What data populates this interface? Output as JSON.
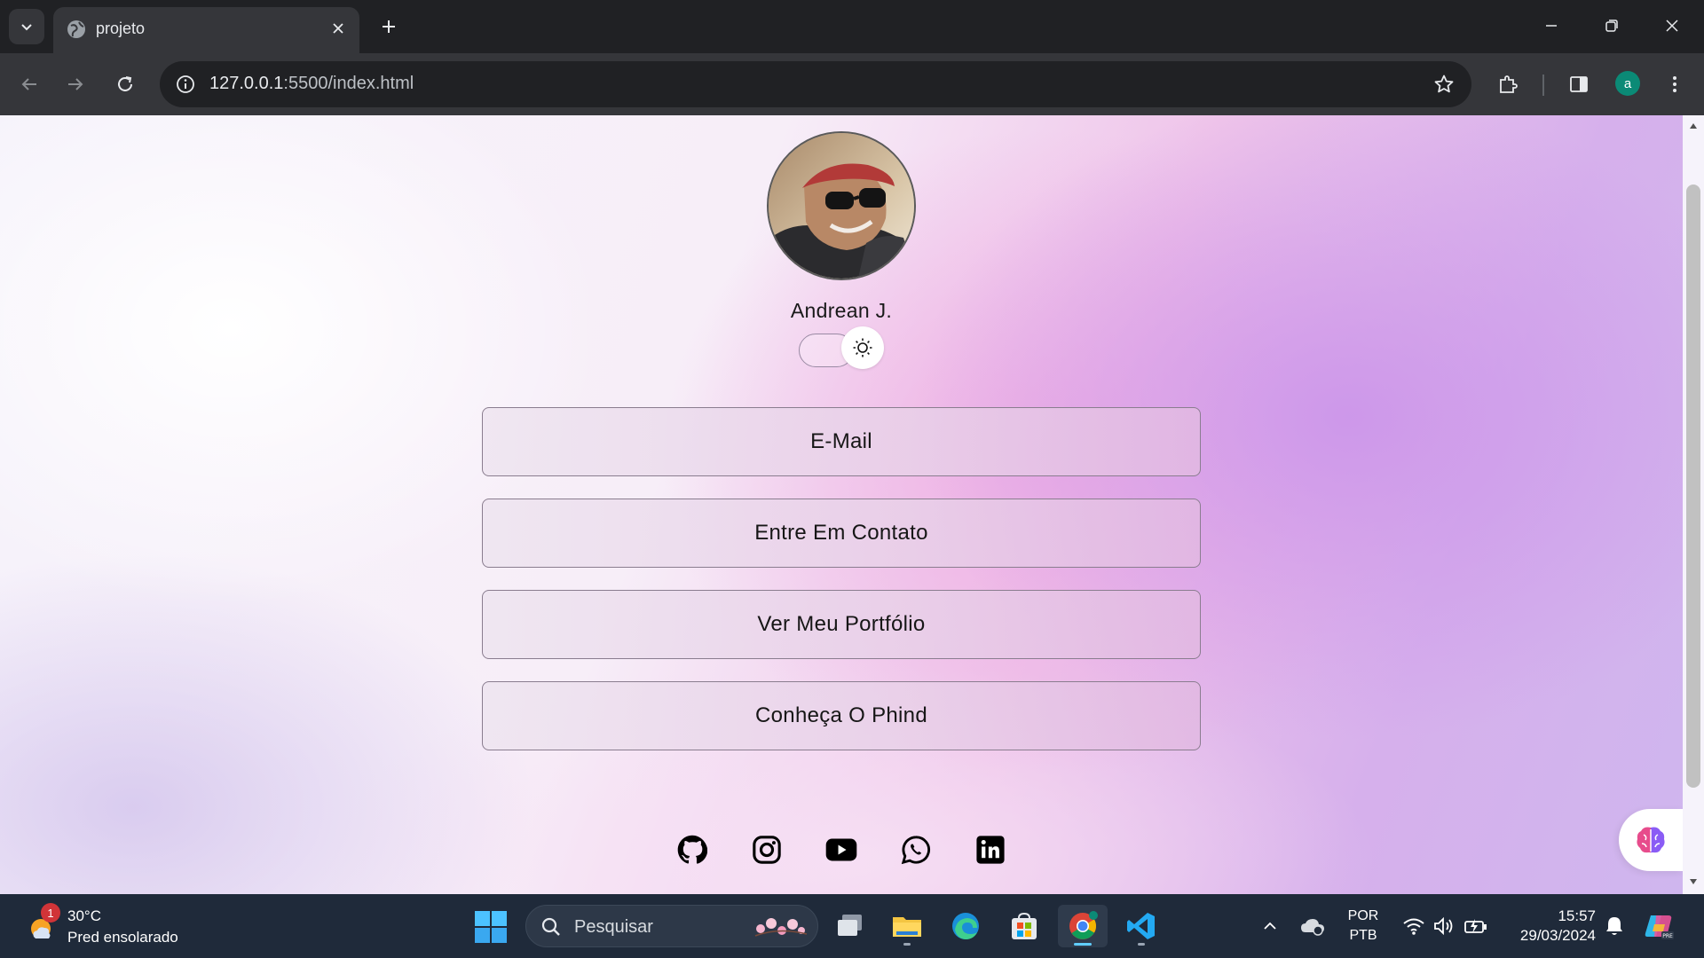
{
  "browser": {
    "tab_title": "projeto",
    "url_host": "127.0.0.1",
    "url_path": ":5500/index.html",
    "profile_initial": "a"
  },
  "page": {
    "name": "Andrean J.",
    "theme_toggle": "light",
    "links": [
      {
        "label": "E-Mail"
      },
      {
        "label": "Entre Em Contato"
      },
      {
        "label": "Ver Meu Portfólio"
      },
      {
        "label": "Conheça O Phind"
      }
    ],
    "social_icons": [
      "github-icon",
      "instagram-icon",
      "youtube-icon",
      "whatsapp-icon",
      "linkedin-icon"
    ]
  },
  "taskbar": {
    "weather_temp": "30°C",
    "weather_desc": "Pred ensolarado",
    "weather_badge": "1",
    "search_placeholder": "Pesquisar",
    "lang_top": "POR",
    "lang_bottom": "PTB",
    "time": "15:57",
    "date": "29/03/2024"
  },
  "colors": {
    "chrome_dark": "#202124",
    "chrome_toolbar": "#35363a",
    "taskbar": "#1f2a3a",
    "accent_blue": "#60cdff",
    "profile_green": "#0b8a76"
  }
}
